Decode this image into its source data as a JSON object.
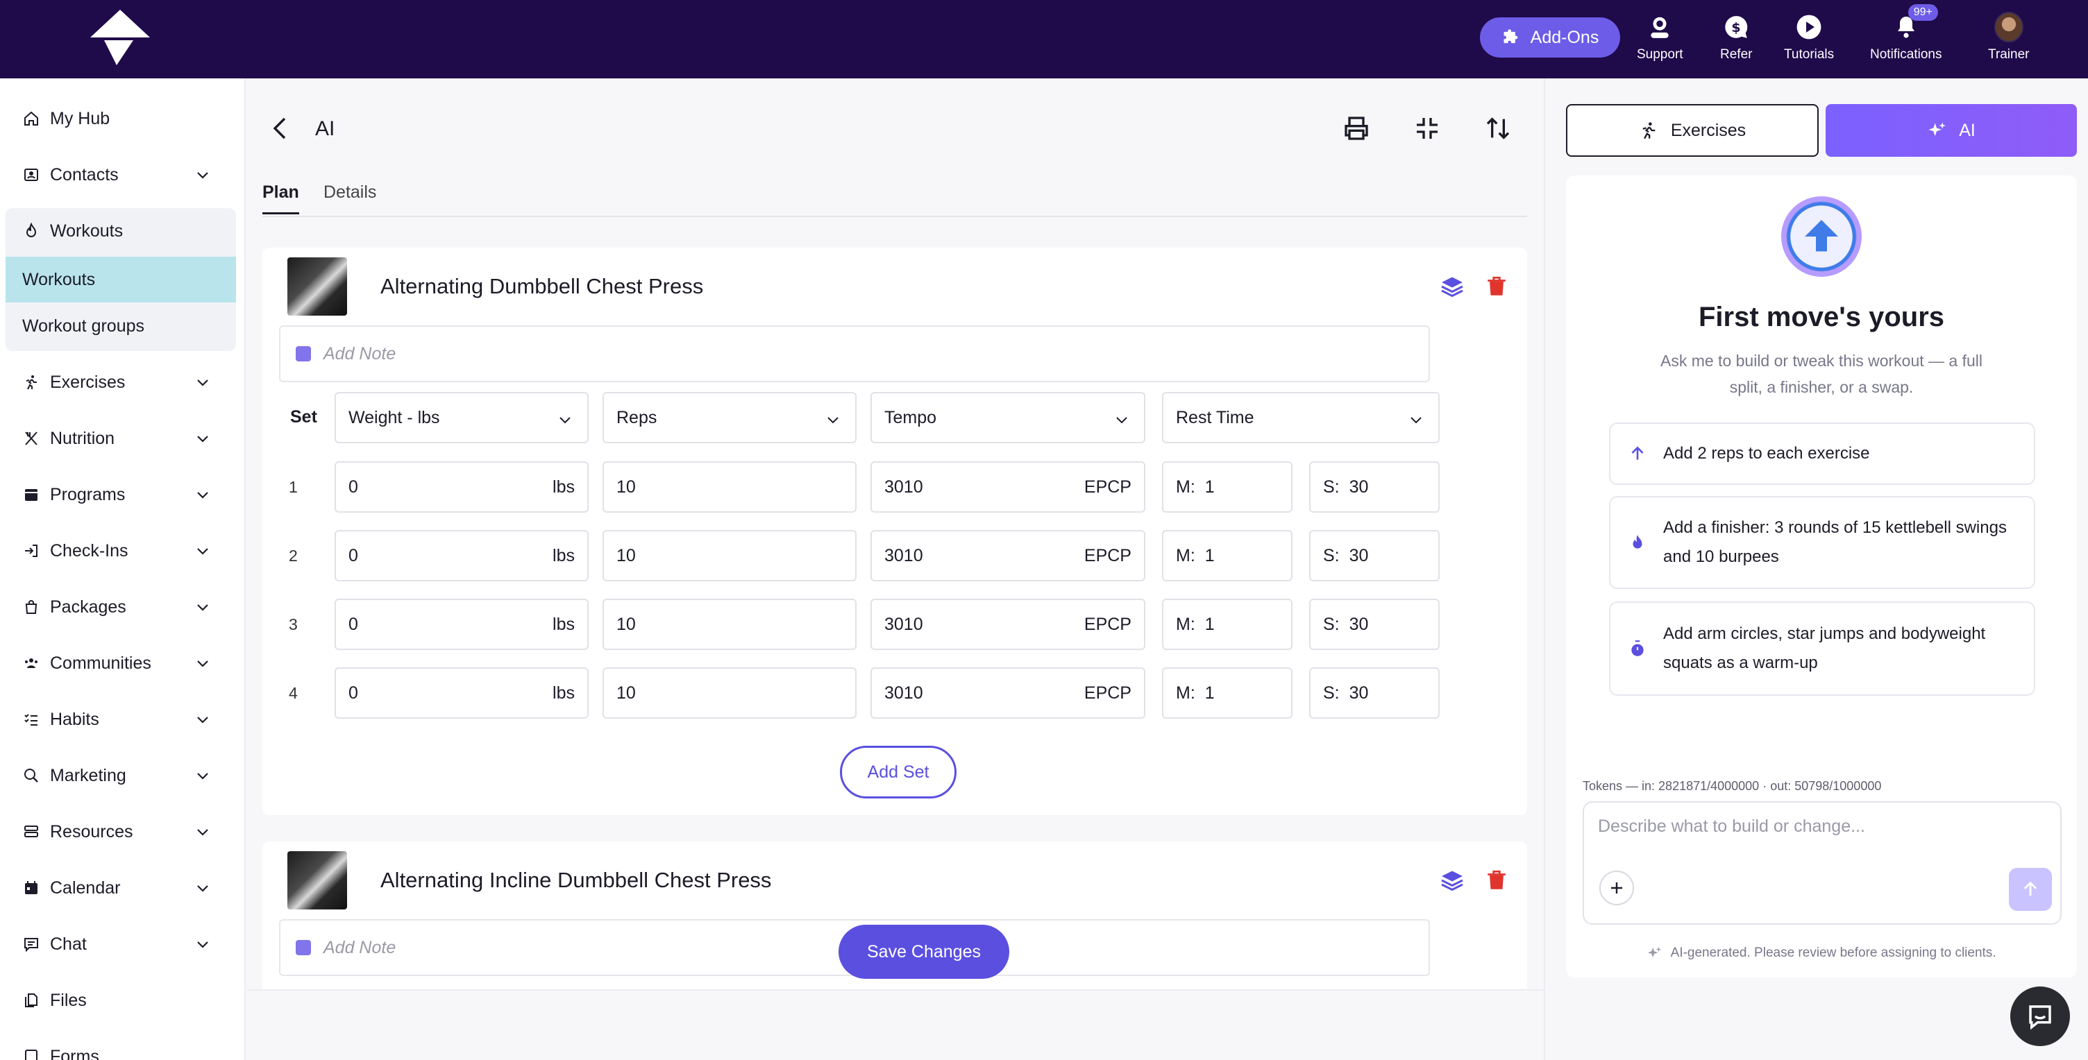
{
  "topbar": {
    "addons_label": "Add-Ons",
    "items": [
      {
        "label": "Support",
        "icon": "headset-icon"
      },
      {
        "label": "Refer",
        "icon": "dollar-chat-icon"
      },
      {
        "label": "Tutorials",
        "icon": "play-icon"
      },
      {
        "label": "Notifications",
        "icon": "bell-icon",
        "badge": "99+"
      },
      {
        "label": "Trainer",
        "icon": "avatar"
      }
    ]
  },
  "sidebar": {
    "items": [
      {
        "label": "My Hub",
        "icon": "home-icon"
      },
      {
        "label": "Contacts",
        "icon": "contacts-icon"
      },
      {
        "label": "Workouts",
        "icon": "flame-icon"
      },
      {
        "label": "Exercises",
        "icon": "running-icon"
      },
      {
        "label": "Nutrition",
        "icon": "utensils-icon"
      },
      {
        "label": "Programs",
        "icon": "calendar-grid-icon"
      },
      {
        "label": "Check-Ins",
        "icon": "check-in-icon"
      },
      {
        "label": "Packages",
        "icon": "bag-icon"
      },
      {
        "label": "Communities",
        "icon": "people-icon"
      },
      {
        "label": "Habits",
        "icon": "checklist-icon"
      },
      {
        "label": "Marketing",
        "icon": "search-chart-icon"
      },
      {
        "label": "Resources",
        "icon": "stack-icon"
      },
      {
        "label": "Calendar",
        "icon": "calendar-icon"
      },
      {
        "label": "Chat",
        "icon": "chat-icon"
      },
      {
        "label": "Files",
        "icon": "files-icon"
      },
      {
        "label": "Forms",
        "icon": "forms-icon"
      }
    ],
    "workouts_sub": [
      "Workouts",
      "Workout groups"
    ]
  },
  "main": {
    "title": "AI",
    "tabs": [
      "Plan",
      "Details"
    ],
    "exercises": [
      {
        "name": "Alternating Dumbbell Chest Press",
        "note_placeholder": "Add Note",
        "columns": {
          "set": "Set",
          "weight": "Weight - lbs",
          "reps": "Reps",
          "tempo": "Tempo",
          "rest": "Rest Time"
        },
        "sets": [
          {
            "num": "1",
            "weight": "0",
            "unit": "lbs",
            "reps": "10",
            "tempo": "3010",
            "tempo_suffix": "EPCP",
            "min_label": "M:",
            "min": "1",
            "sec_label": "S:",
            "sec": "30"
          },
          {
            "num": "2",
            "weight": "0",
            "unit": "lbs",
            "reps": "10",
            "tempo": "3010",
            "tempo_suffix": "EPCP",
            "min_label": "M:",
            "min": "1",
            "sec_label": "S:",
            "sec": "30"
          },
          {
            "num": "3",
            "weight": "0",
            "unit": "lbs",
            "reps": "10",
            "tempo": "3010",
            "tempo_suffix": "EPCP",
            "min_label": "M:",
            "min": "1",
            "sec_label": "S:",
            "sec": "30"
          },
          {
            "num": "4",
            "weight": "0",
            "unit": "lbs",
            "reps": "10",
            "tempo": "3010",
            "tempo_suffix": "EPCP",
            "min_label": "M:",
            "min": "1",
            "sec_label": "S:",
            "sec": "30"
          }
        ],
        "add_set_label": "Add Set"
      },
      {
        "name": "Alternating Incline Dumbbell Chest Press",
        "note_placeholder": "Add Note"
      }
    ],
    "save_label": "Save Changes"
  },
  "right_panel": {
    "exercises_tab": "Exercises",
    "ai_tab": "AI",
    "heading": "First move's yours",
    "subtitle": "Ask me to build or tweak this workout — a full split, a finisher, or a swap.",
    "suggestions": [
      {
        "text": "Add 2 reps to each exercise",
        "icon": "arrow-up-icon"
      },
      {
        "text": "Add a finisher: 3 rounds of 15 kettlebell swings and 10 burpees",
        "icon": "flame-icon"
      },
      {
        "text": "Add arm circles, star jumps and bodyweight squats as a warm-up",
        "icon": "stopwatch-icon"
      }
    ],
    "tokens": "Tokens — in: 2821871/4000000 · out: 50798/1000000",
    "input_placeholder": "Describe what to build or change...",
    "disclaimer": "AI-generated. Please review before assigning to clients."
  },
  "colors": {
    "topbar": "#1f0a4a",
    "accent": "#5b4fe0",
    "active_sub": "#b9e4ec",
    "danger": "#e0342c"
  }
}
